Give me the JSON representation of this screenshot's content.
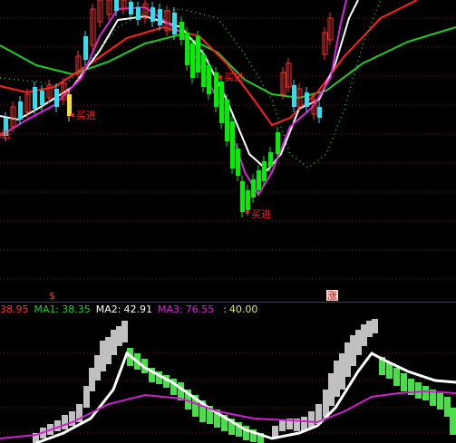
{
  "colors": {
    "background": "#000000",
    "grid": "#7a1018",
    "up_candle": "#ff3030",
    "down_candle": "#00ee00",
    "cyan_candle": "#33ddee",
    "yellow_candle": "#f0e040",
    "ma_white": "#ffffff",
    "ma_red": "#ff2020",
    "ma_green": "#22cc22",
    "ma_magenta": "#dd22dd",
    "ma_dotted": "#22cc22",
    "ind_gray": "#c0c0c0",
    "ind_green": "#4cdd4c",
    "ind_magenta": "#d020d0"
  },
  "signals": [
    {
      "label": "买进"
    },
    {
      "label": "买进"
    },
    {
      "label": "买进"
    },
    {
      "label": "买进"
    }
  ],
  "markers": {
    "dollar": "$",
    "zhang": "涨"
  },
  "legend": {
    "first_value": "38.95",
    "ma1_label": "MA1:",
    "ma1_value": "38.35",
    "ma2_label": "MA2:",
    "ma2_value": "42.91",
    "ma3_label": "MA3:",
    "ma3_value": "76.55",
    "extra_label": ":",
    "extra_value": "40.00"
  }
}
